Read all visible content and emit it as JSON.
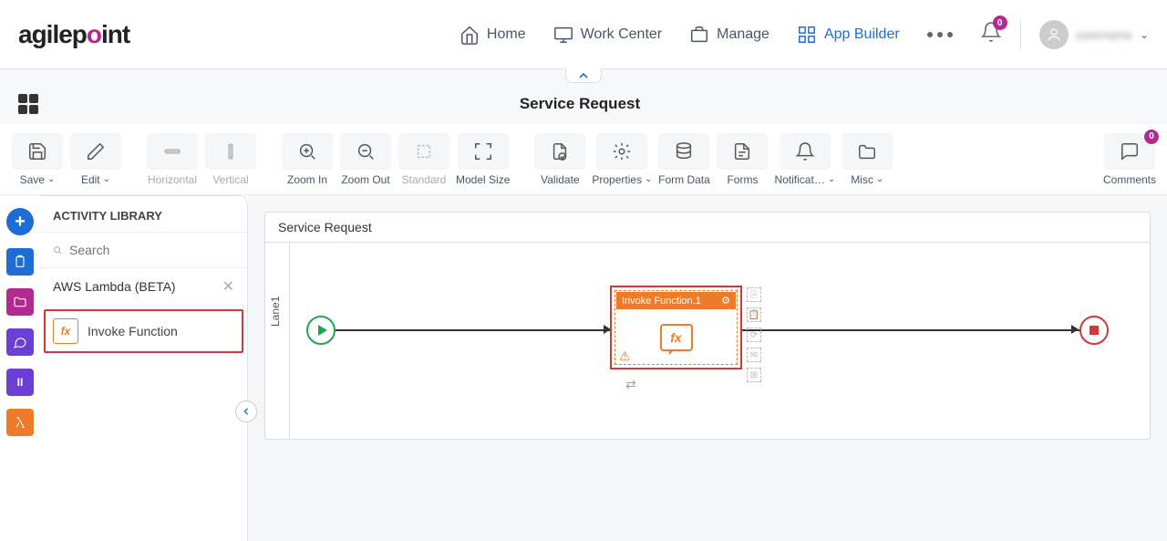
{
  "header": {
    "logo_text": "agilepoint",
    "nav": {
      "home": "Home",
      "work_center": "Work Center",
      "manage": "Manage",
      "app_builder": "App Builder"
    },
    "notifications_count": "0",
    "username": "username"
  },
  "page": {
    "title": "Service Request"
  },
  "toolbar": {
    "save": "Save",
    "edit": "Edit",
    "horizontal": "Horizontal",
    "vertical": "Vertical",
    "zoom_in": "Zoom In",
    "zoom_out": "Zoom Out",
    "standard": "Standard",
    "model_size": "Model Size",
    "validate": "Validate",
    "properties": "Properties",
    "form_data": "Form Data",
    "forms": "Forms",
    "notifications": "Notificat…",
    "misc": "Misc",
    "comments": "Comments",
    "comments_count": "0"
  },
  "library": {
    "header": "ACTIVITY LIBRARY",
    "search_placeholder": "Search",
    "category": "AWS Lambda (BETA)",
    "item_invoke": "Invoke Function"
  },
  "canvas": {
    "title": "Service Request",
    "lane": "Lane1",
    "task": {
      "title": "Invoke Function.1",
      "fx": "fx"
    }
  }
}
